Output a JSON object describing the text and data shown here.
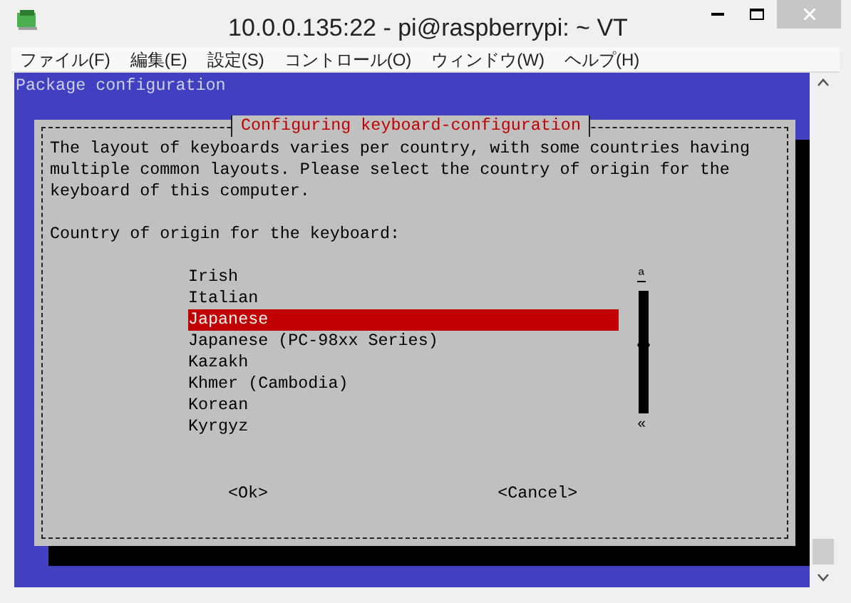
{
  "window": {
    "title": "10.0.0.135:22 - pi@raspberrypi: ~ VT"
  },
  "menu": [
    {
      "label": "ファイル(F)"
    },
    {
      "label": "編集(E)"
    },
    {
      "label": "設定(S)"
    },
    {
      "label": "コントロール(O)"
    },
    {
      "label": "ウィンドウ(W)"
    },
    {
      "label": "ヘルプ(H)"
    }
  ],
  "terminal": {
    "header": "Package configuration",
    "dialog": {
      "title": "Configuring keyboard-configuration",
      "description": "The layout of keyboards varies per country, with some countries having multiple common layouts. Please select the country of origin for the keyboard of this computer.",
      "prompt": "Country of origin for the keyboard:",
      "items": [
        {
          "label": "Irish",
          "selected": false
        },
        {
          "label": "Italian",
          "selected": false
        },
        {
          "label": "Japanese",
          "selected": true
        },
        {
          "label": "Japanese (PC-98xx Series)",
          "selected": false
        },
        {
          "label": "Kazakh",
          "selected": false
        },
        {
          "label": "Khmer (Cambodia)",
          "selected": false
        },
        {
          "label": "Korean",
          "selected": false
        },
        {
          "label": "Kyrgyz",
          "selected": false
        }
      ],
      "scroll_top_mark": "ª",
      "scroll_bottom_mark": "«",
      "buttons": [
        {
          "label": "<Ok>"
        },
        {
          "label": "<Cancel>"
        }
      ]
    }
  }
}
